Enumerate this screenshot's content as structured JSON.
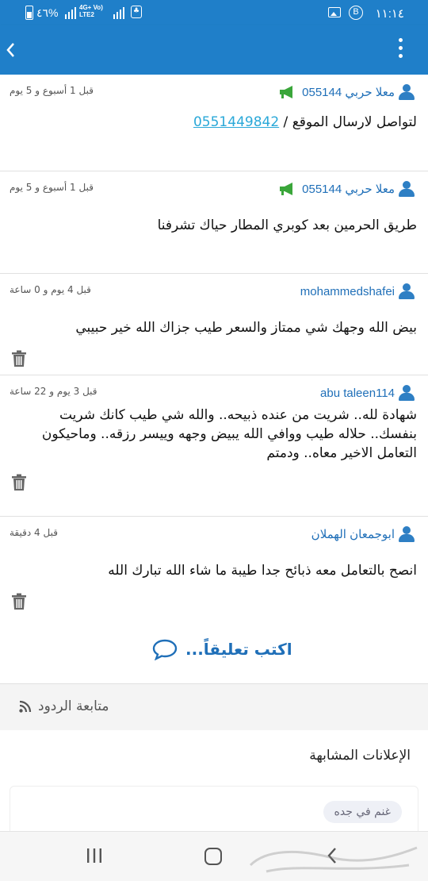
{
  "status_bar": {
    "time": "١١:١٤",
    "battery_percent": "٤٦%",
    "network": "4G+ Vo)) LTE2",
    "notification_badge": "B",
    "notif_icon": "app-notification-icon"
  },
  "header": {
    "back_icon": "chevron-left-icon",
    "menu_icon": "more-vert-icon"
  },
  "comments": [
    {
      "user": "معلا حربي 055144",
      "time": "قبل 1 أسبوع و 5 يوم",
      "text_prefix": "لتواصل لارسال الموقع / ",
      "phone": "0551449842",
      "has_megaphone": true,
      "deletable": false
    },
    {
      "user": "معلا حربي 055144",
      "time": "قبل 1 أسبوع و 5 يوم",
      "text": "طريق الحرمين بعد كوبري المطار حياك تشرفنا",
      "has_megaphone": true,
      "deletable": false
    },
    {
      "user": "mohammedshafei",
      "time": "قبل 4 يوم و 0 ساعة",
      "text": "بيض الله وجهك شي ممتاز والسعر طيب جزاك الله خير حبيبي",
      "deletable": true
    },
    {
      "user": "abu taleen114",
      "time": "قبل 3 يوم و 22 ساعة",
      "text": "شهادة لله.. شريت من عنده ذبيحه.. والله شي طيب كانك شريت بنفسك.. حلاله طيب ووافي الله يبيض وجهه وييسر رزقه.. وماحيكون التعامل الاخير معاه.. ودمتم",
      "deletable": true
    },
    {
      "user": "ابوجمعان الهملان",
      "time": "قبل 4 دقيقة",
      "text": "انصح بالتعامل معه ذبائح جدا طيبة ما شاء الله تبارك الله",
      "deletable": true
    }
  ],
  "write_comment": {
    "label": "اكتب تعليقاً..."
  },
  "follow": {
    "label": "متابعة الردود"
  },
  "similar": {
    "title": "الإعلانات المشابهة",
    "item": "غنم في جده"
  },
  "colors": {
    "primary": "#1f7fc9",
    "link": "#1f6fb8",
    "megaphone": "#3aa63a"
  }
}
